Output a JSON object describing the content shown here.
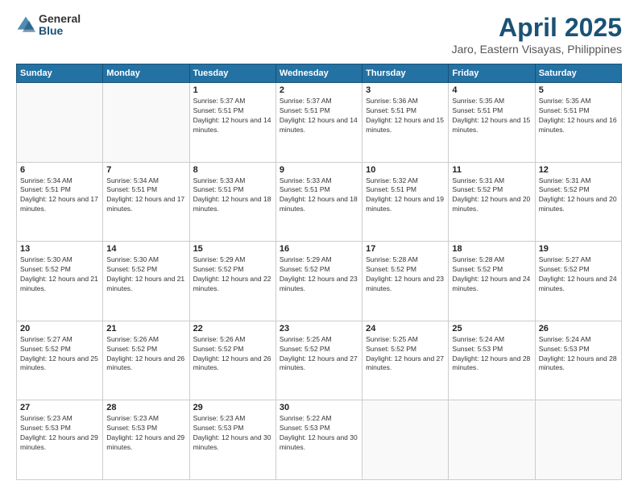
{
  "logo": {
    "general": "General",
    "blue": "Blue"
  },
  "header": {
    "month": "April 2025",
    "location": "Jaro, Eastern Visayas, Philippines"
  },
  "weekdays": [
    "Sunday",
    "Monday",
    "Tuesday",
    "Wednesday",
    "Thursday",
    "Friday",
    "Saturday"
  ],
  "weeks": [
    [
      {
        "day": "",
        "sunrise": "",
        "sunset": "",
        "daylight": ""
      },
      {
        "day": "",
        "sunrise": "",
        "sunset": "",
        "daylight": ""
      },
      {
        "day": "1",
        "sunrise": "Sunrise: 5:37 AM",
        "sunset": "Sunset: 5:51 PM",
        "daylight": "Daylight: 12 hours and 14 minutes."
      },
      {
        "day": "2",
        "sunrise": "Sunrise: 5:37 AM",
        "sunset": "Sunset: 5:51 PM",
        "daylight": "Daylight: 12 hours and 14 minutes."
      },
      {
        "day": "3",
        "sunrise": "Sunrise: 5:36 AM",
        "sunset": "Sunset: 5:51 PM",
        "daylight": "Daylight: 12 hours and 15 minutes."
      },
      {
        "day": "4",
        "sunrise": "Sunrise: 5:35 AM",
        "sunset": "Sunset: 5:51 PM",
        "daylight": "Daylight: 12 hours and 15 minutes."
      },
      {
        "day": "5",
        "sunrise": "Sunrise: 5:35 AM",
        "sunset": "Sunset: 5:51 PM",
        "daylight": "Daylight: 12 hours and 16 minutes."
      }
    ],
    [
      {
        "day": "6",
        "sunrise": "Sunrise: 5:34 AM",
        "sunset": "Sunset: 5:51 PM",
        "daylight": "Daylight: 12 hours and 17 minutes."
      },
      {
        "day": "7",
        "sunrise": "Sunrise: 5:34 AM",
        "sunset": "Sunset: 5:51 PM",
        "daylight": "Daylight: 12 hours and 17 minutes."
      },
      {
        "day": "8",
        "sunrise": "Sunrise: 5:33 AM",
        "sunset": "Sunset: 5:51 PM",
        "daylight": "Daylight: 12 hours and 18 minutes."
      },
      {
        "day": "9",
        "sunrise": "Sunrise: 5:33 AM",
        "sunset": "Sunset: 5:51 PM",
        "daylight": "Daylight: 12 hours and 18 minutes."
      },
      {
        "day": "10",
        "sunrise": "Sunrise: 5:32 AM",
        "sunset": "Sunset: 5:51 PM",
        "daylight": "Daylight: 12 hours and 19 minutes."
      },
      {
        "day": "11",
        "sunrise": "Sunrise: 5:31 AM",
        "sunset": "Sunset: 5:52 PM",
        "daylight": "Daylight: 12 hours and 20 minutes."
      },
      {
        "day": "12",
        "sunrise": "Sunrise: 5:31 AM",
        "sunset": "Sunset: 5:52 PM",
        "daylight": "Daylight: 12 hours and 20 minutes."
      }
    ],
    [
      {
        "day": "13",
        "sunrise": "Sunrise: 5:30 AM",
        "sunset": "Sunset: 5:52 PM",
        "daylight": "Daylight: 12 hours and 21 minutes."
      },
      {
        "day": "14",
        "sunrise": "Sunrise: 5:30 AM",
        "sunset": "Sunset: 5:52 PM",
        "daylight": "Daylight: 12 hours and 21 minutes."
      },
      {
        "day": "15",
        "sunrise": "Sunrise: 5:29 AM",
        "sunset": "Sunset: 5:52 PM",
        "daylight": "Daylight: 12 hours and 22 minutes."
      },
      {
        "day": "16",
        "sunrise": "Sunrise: 5:29 AM",
        "sunset": "Sunset: 5:52 PM",
        "daylight": "Daylight: 12 hours and 23 minutes."
      },
      {
        "day": "17",
        "sunrise": "Sunrise: 5:28 AM",
        "sunset": "Sunset: 5:52 PM",
        "daylight": "Daylight: 12 hours and 23 minutes."
      },
      {
        "day": "18",
        "sunrise": "Sunrise: 5:28 AM",
        "sunset": "Sunset: 5:52 PM",
        "daylight": "Daylight: 12 hours and 24 minutes."
      },
      {
        "day": "19",
        "sunrise": "Sunrise: 5:27 AM",
        "sunset": "Sunset: 5:52 PM",
        "daylight": "Daylight: 12 hours and 24 minutes."
      }
    ],
    [
      {
        "day": "20",
        "sunrise": "Sunrise: 5:27 AM",
        "sunset": "Sunset: 5:52 PM",
        "daylight": "Daylight: 12 hours and 25 minutes."
      },
      {
        "day": "21",
        "sunrise": "Sunrise: 5:26 AM",
        "sunset": "Sunset: 5:52 PM",
        "daylight": "Daylight: 12 hours and 26 minutes."
      },
      {
        "day": "22",
        "sunrise": "Sunrise: 5:26 AM",
        "sunset": "Sunset: 5:52 PM",
        "daylight": "Daylight: 12 hours and 26 minutes."
      },
      {
        "day": "23",
        "sunrise": "Sunrise: 5:25 AM",
        "sunset": "Sunset: 5:52 PM",
        "daylight": "Daylight: 12 hours and 27 minutes."
      },
      {
        "day": "24",
        "sunrise": "Sunrise: 5:25 AM",
        "sunset": "Sunset: 5:52 PM",
        "daylight": "Daylight: 12 hours and 27 minutes."
      },
      {
        "day": "25",
        "sunrise": "Sunrise: 5:24 AM",
        "sunset": "Sunset: 5:53 PM",
        "daylight": "Daylight: 12 hours and 28 minutes."
      },
      {
        "day": "26",
        "sunrise": "Sunrise: 5:24 AM",
        "sunset": "Sunset: 5:53 PM",
        "daylight": "Daylight: 12 hours and 28 minutes."
      }
    ],
    [
      {
        "day": "27",
        "sunrise": "Sunrise: 5:23 AM",
        "sunset": "Sunset: 5:53 PM",
        "daylight": "Daylight: 12 hours and 29 minutes."
      },
      {
        "day": "28",
        "sunrise": "Sunrise: 5:23 AM",
        "sunset": "Sunset: 5:53 PM",
        "daylight": "Daylight: 12 hours and 29 minutes."
      },
      {
        "day": "29",
        "sunrise": "Sunrise: 5:23 AM",
        "sunset": "Sunset: 5:53 PM",
        "daylight": "Daylight: 12 hours and 30 minutes."
      },
      {
        "day": "30",
        "sunrise": "Sunrise: 5:22 AM",
        "sunset": "Sunset: 5:53 PM",
        "daylight": "Daylight: 12 hours and 30 minutes."
      },
      {
        "day": "",
        "sunrise": "",
        "sunset": "",
        "daylight": ""
      },
      {
        "day": "",
        "sunrise": "",
        "sunset": "",
        "daylight": ""
      },
      {
        "day": "",
        "sunrise": "",
        "sunset": "",
        "daylight": ""
      }
    ]
  ]
}
